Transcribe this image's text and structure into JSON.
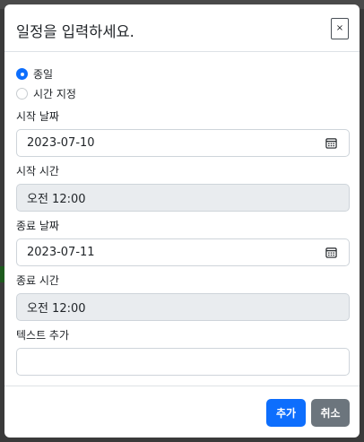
{
  "modal": {
    "title": "일정을 입력하세요.",
    "close_label": "×"
  },
  "radios": [
    {
      "label": "종일",
      "checked": true
    },
    {
      "label": "시간 지정",
      "checked": false
    }
  ],
  "start_date": {
    "label": "시작 날짜",
    "value": "2023-07-10"
  },
  "start_time": {
    "label": "시작 시간",
    "value": "오전 12:00"
  },
  "end_date": {
    "label": "종료 날짜",
    "value": "2023-07-11"
  },
  "end_time": {
    "label": "종료 시간",
    "value": "오전 12:00"
  },
  "text": {
    "label": "텍스트 추가",
    "value": ""
  },
  "footer": {
    "add_label": "추가",
    "cancel_label": "취소"
  },
  "colors": {
    "primary": "#0d6efd",
    "secondary": "#6c757d",
    "disabled_bg": "#e9ecef"
  }
}
